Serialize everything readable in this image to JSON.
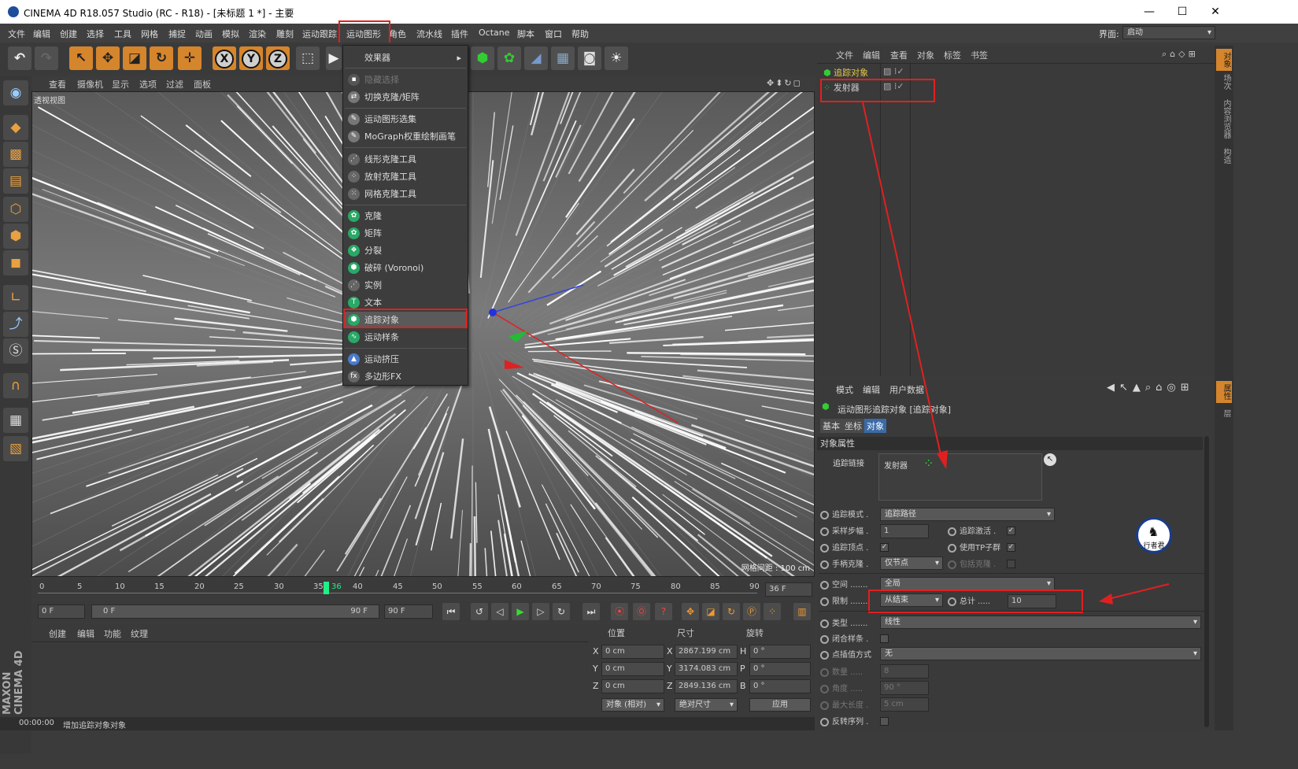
{
  "title": "CINEMA 4D R18.057 Studio (RC - R18) - [未标题 1 *] - 主要",
  "window_buttons": {
    "min": "—",
    "max": "☐",
    "close": "✕"
  },
  "menubar": [
    "文件",
    "编辑",
    "创建",
    "选择",
    "工具",
    "网格",
    "捕捉",
    "动画",
    "模拟",
    "渲染",
    "雕刻",
    "运动跟踪",
    "运动图形",
    "角色",
    "流水线",
    "插件",
    "Octane",
    "脚本",
    "窗口",
    "帮助"
  ],
  "layout_label": "界面:",
  "layout_value": "启动",
  "viewport_menu": [
    "查看",
    "摄像机",
    "显示",
    "选项",
    "过滤",
    "面板"
  ],
  "viewport_label": "透视视图",
  "grid_spacing": "网格间距 : 100 cm",
  "menu_items": [
    {
      "label": "效果器",
      "disabled": false
    },
    {
      "label": "隐藏选择",
      "disabled": true
    },
    {
      "label": "切换克隆/矩阵",
      "disabled": false
    },
    {
      "label": "运动图形选集",
      "disabled": false
    },
    {
      "label": "MoGraph权重绘制画笔",
      "disabled": false
    },
    {
      "label": "线形克隆工具",
      "disabled": false
    },
    {
      "label": "放射克隆工具",
      "disabled": false
    },
    {
      "label": "网格克隆工具",
      "disabled": false
    },
    {
      "label": "克隆",
      "disabled": false
    },
    {
      "label": "矩阵",
      "disabled": false
    },
    {
      "label": "分裂",
      "disabled": false
    },
    {
      "label": "破碎 (Voronoi)",
      "disabled": false
    },
    {
      "label": "实例",
      "disabled": false
    },
    {
      "label": "文本",
      "disabled": false
    },
    {
      "label": "追踪对象",
      "disabled": false
    },
    {
      "label": "运动样条",
      "disabled": false
    },
    {
      "label": "运动挤压",
      "disabled": false
    },
    {
      "label": "多边形FX",
      "disabled": false
    }
  ],
  "timeline_ticks": [
    "0",
    "5",
    "10",
    "15",
    "20",
    "25",
    "30",
    "35",
    "36",
    "40",
    "45",
    "50",
    "55",
    "60",
    "65",
    "70",
    "75",
    "80",
    "85",
    "90"
  ],
  "frame_end_field": "36 F",
  "controls": {
    "start": "0 F",
    "range_start": "0 F",
    "range_end": "90 F",
    "end": "90 F"
  },
  "mat_menu": [
    "创建",
    "编辑",
    "功能",
    "纹理"
  ],
  "coord": {
    "headers": [
      "位置",
      "尺寸",
      "旋转"
    ],
    "rows": [
      {
        "axis": "X",
        "pos": "0 cm",
        "size_axis": "X",
        "size": "2867.199 cm",
        "rot_axis": "H",
        "rot": "0 °"
      },
      {
        "axis": "Y",
        "pos": "0 cm",
        "size_axis": "Y",
        "size": "3174.083 cm",
        "rot_axis": "P",
        "rot": "0 °"
      },
      {
        "axis": "Z",
        "pos": "0 cm",
        "size_axis": "Z",
        "size": "2849.136 cm",
        "rot_axis": "B",
        "rot": "0 °"
      }
    ],
    "mode": "对象 (相对)",
    "size_mode": "绝对尺寸",
    "apply": "应用"
  },
  "status": {
    "time": "00:00:00",
    "message": "增加追踪对象对象"
  },
  "objmgr_menu": [
    "文件",
    "编辑",
    "查看",
    "对象",
    "标签",
    "书签"
  ],
  "objects": [
    "追踪对象",
    "发射器"
  ],
  "attr_menu": [
    "模式",
    "编辑",
    "用户数据"
  ],
  "attr_title": "运动图形追踪对象 [追踪对象]",
  "attr_tabs": [
    "基本",
    "坐标",
    "对象"
  ],
  "section": "对象属性",
  "link_label": "追踪链接",
  "link_value": "发射器",
  "attrs": {
    "trace_mode_label": "追踪模式 .",
    "trace_mode": "追踪路径",
    "sampling_label": "采样步幅 .",
    "sampling": "1",
    "trace_active_label": "追踪激活 .",
    "trace_vertices_label": "追踪顶点 .",
    "use_tp_label": "使用TP子群",
    "handle_clone_label": "手柄克隆 .",
    "handle_clone": "仅节点",
    "include_clone_label": "包括克隆 .",
    "space_label": "空间 .......",
    "space": "全局",
    "limit_label": "限制 .......",
    "limit": "从结束",
    "total_label": "总计 .....",
    "total": "10",
    "type_label": "类型 .......",
    "type": "线性",
    "closed_label": "闭合样条 .",
    "interp_label": "点插值方式",
    "interp": "无",
    "count_label": "数量 .....",
    "count": "8",
    "angle_label": "角度 .....",
    "angle": "90 °",
    "maxlen_label": "最大长度 .",
    "maxlen": "5 cm",
    "reverse_label": "反转序列 ."
  },
  "right_tabs": [
    "对象",
    "场次",
    "内容浏览器",
    "构造",
    "属性",
    "层"
  ],
  "logo_text": "行者君",
  "brand": "MAXON CINEMA 4D",
  "colors": {
    "highlight": "#e02020",
    "accent_orange": "#d5852c",
    "green": "#29a866"
  }
}
